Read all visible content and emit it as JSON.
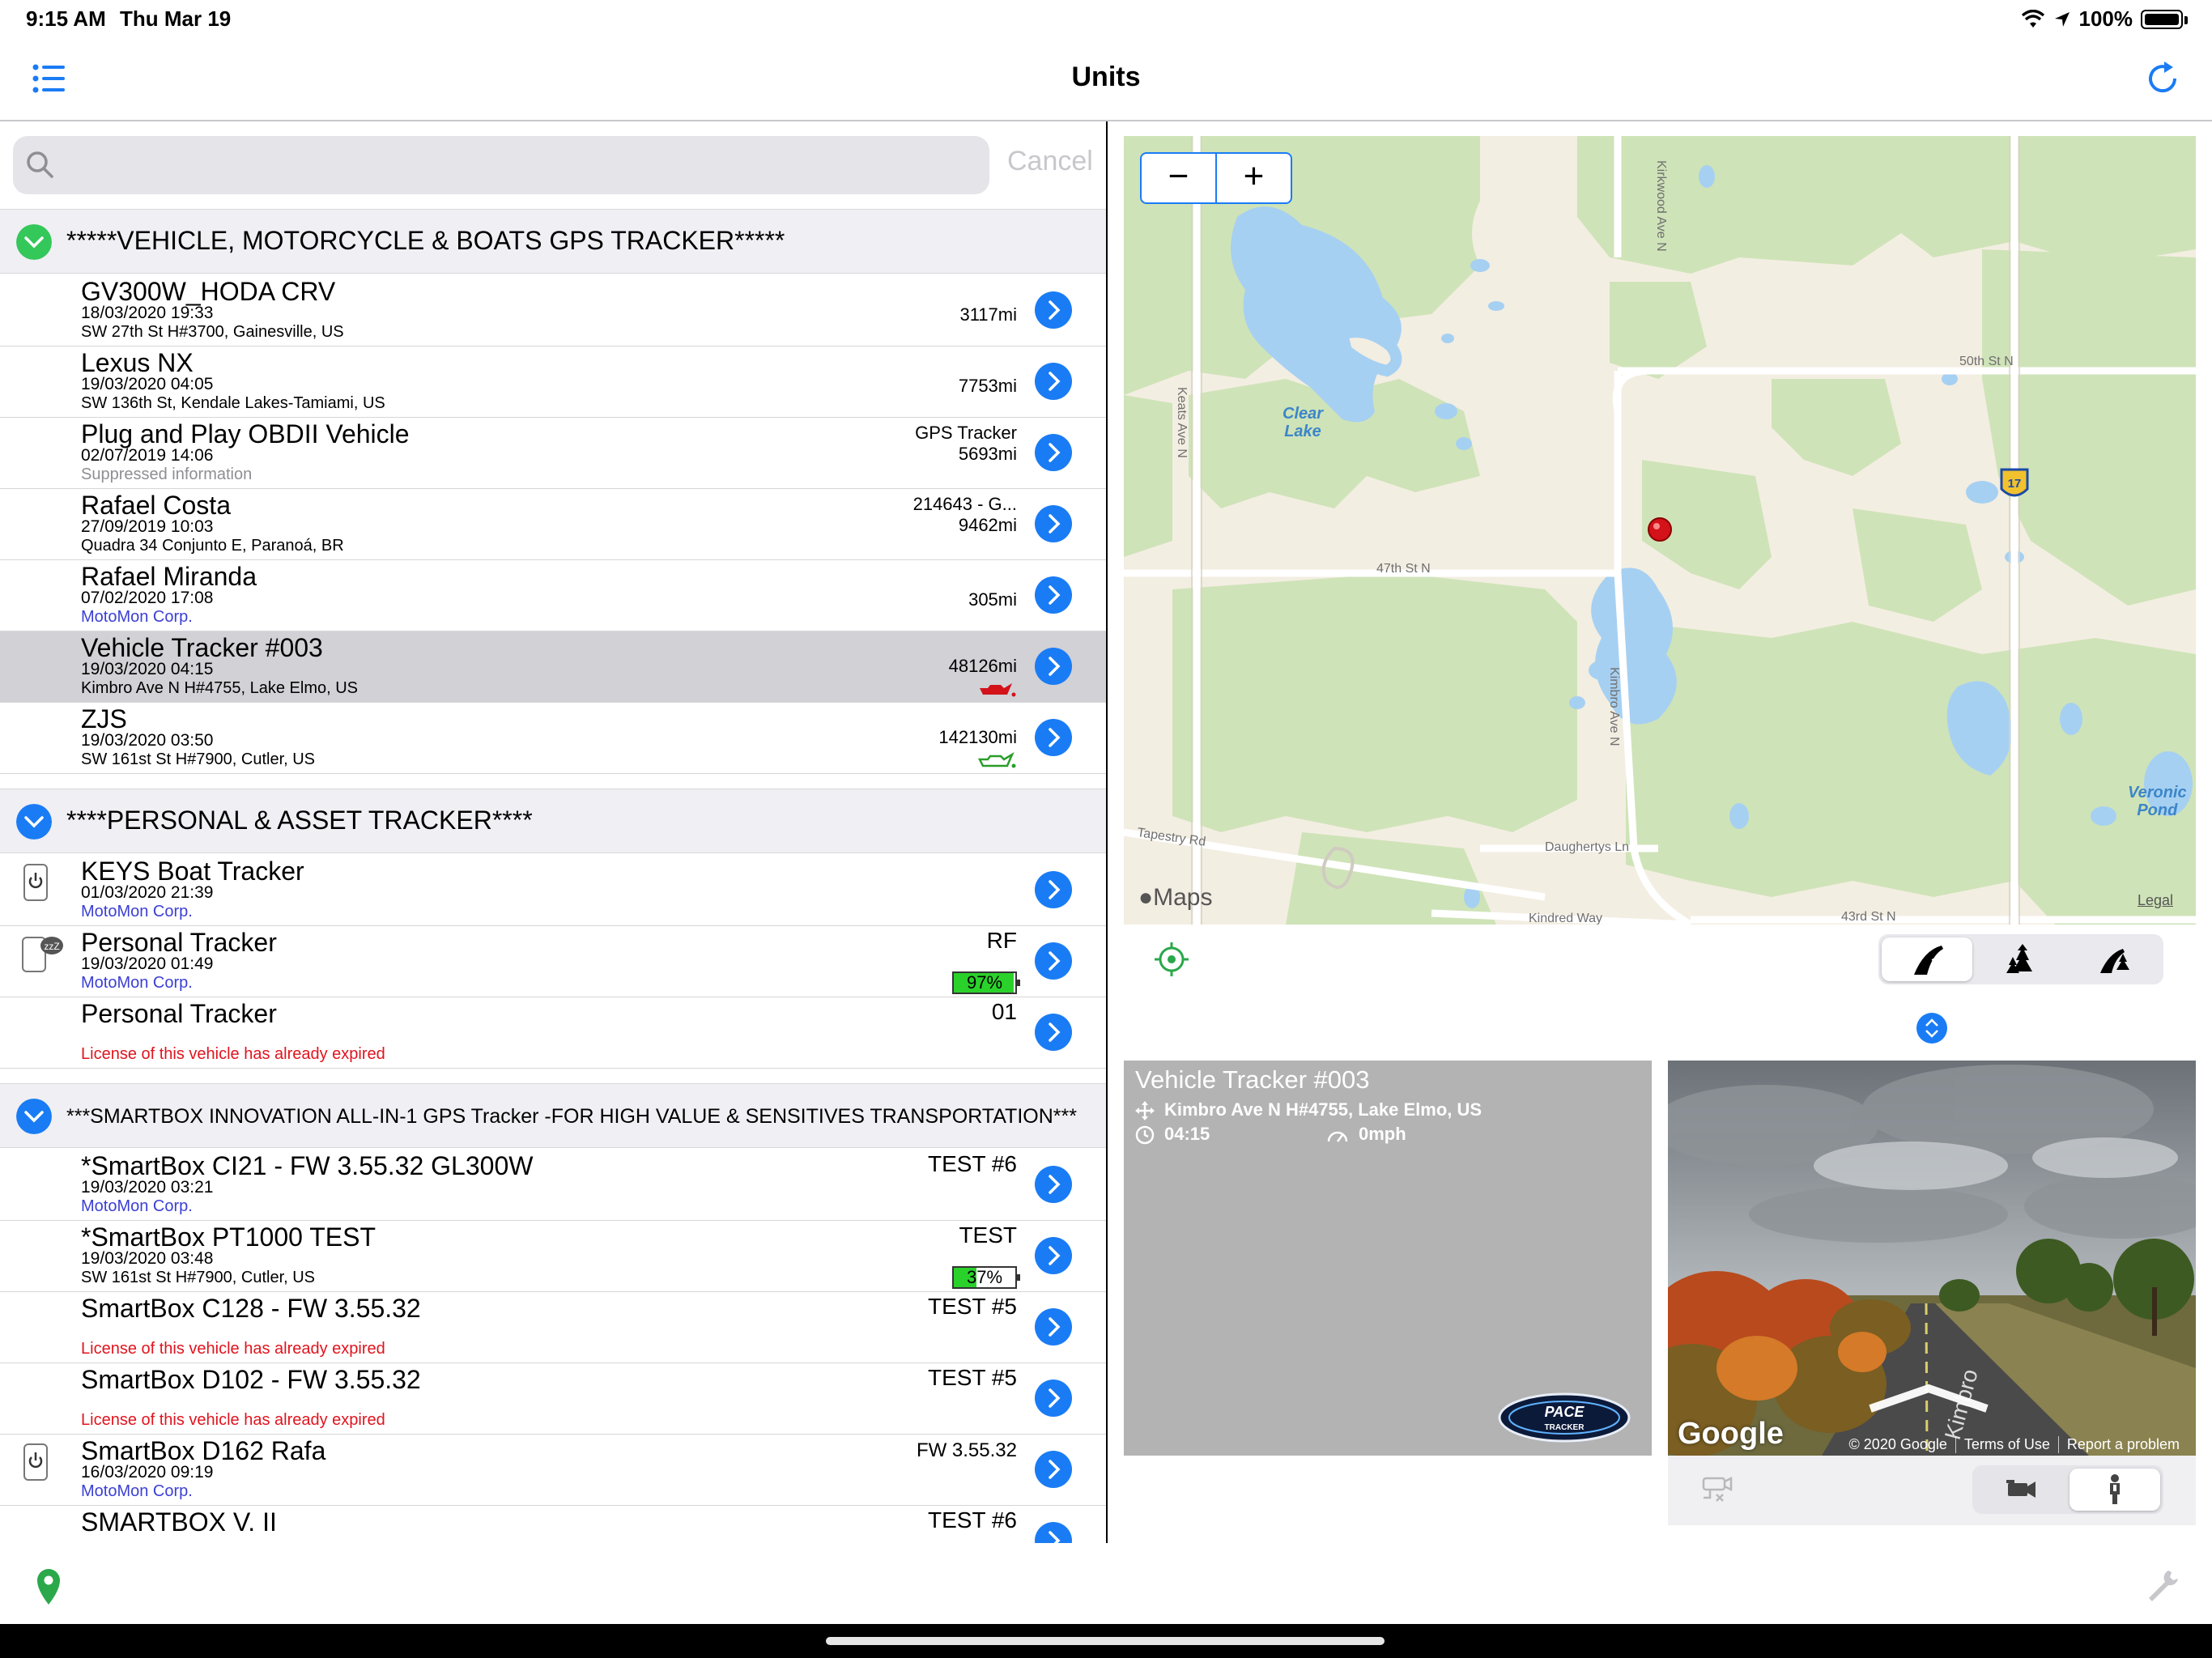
{
  "status": {
    "time": "9:15 AM",
    "date": "Thu Mar 19",
    "battery": "100%"
  },
  "nav": {
    "title": "Units"
  },
  "search": {
    "placeholder": "",
    "cancel": "Cancel"
  },
  "sections": [
    {
      "title": "*****VEHICLE, MOTORCYCLE & BOATS GPS TRACKER*****",
      "color": "#34c759"
    },
    {
      "title": "****PERSONAL & ASSET TRACKER****",
      "color": "#1a7cf5"
    },
    {
      "title": "***SMARTBOX INNOVATION ALL-IN-1 GPS Tracker -FOR HIGH VALUE & SENSITIVES TRANSPORTATION***",
      "color": "#1a7cf5"
    }
  ],
  "units": [
    {
      "name": "GV300W_HODA CRV",
      "time": "18/03/2020 19:33",
      "line3": "SW 27th St H#3700, Gainesville, US",
      "r1": "3117mi"
    },
    {
      "name": "Lexus NX",
      "time": "19/03/2020 04:05",
      "line3": "SW 136th St, Kendale Lakes-Tamiami, US",
      "r1": "7753mi"
    },
    {
      "name": "Plug and Play OBDII Vehicle",
      "time": "02/07/2019 14:06",
      "line3": "Suppressed information",
      "r1": "GPS Tracker",
      "r2": "5693mi"
    },
    {
      "name": "Rafael Costa",
      "time": "27/09/2019 10:03",
      "line3": "Quadra 34 Conjunto E, Paranoá, BR",
      "r1": "214643 - G...",
      "r2": "9462mi"
    },
    {
      "name": "Rafael Miranda",
      "time": "07/02/2020 17:08",
      "line3": "MotoMon Corp.",
      "r1": "305mi"
    },
    {
      "name": "Vehicle Tracker #003",
      "time": "19/03/2020 04:15",
      "line3": "Kimbro Ave N H#4755, Lake Elmo, US",
      "r1": "48126mi"
    },
    {
      "name": "ZJS",
      "time": "19/03/2020 03:50",
      "line3": "SW 161st St H#7900, Cutler, US",
      "r1": "142130mi"
    },
    {
      "name": "KEYS Boat Tracker",
      "time": "01/03/2020 21:39",
      "line3": "MotoMon Corp."
    },
    {
      "name": "Personal Tracker",
      "time": "19/03/2020 01:49",
      "line3": "MotoMon Corp.",
      "rbig": "RF",
      "battery": "97%",
      "battery_level": 0.97
    },
    {
      "name": "Personal Tracker",
      "line3": "License of this vehicle has already expired",
      "rbig": "01"
    },
    {
      "name": "*SmartBox CI21 - FW 3.55.32  GL300W",
      "time": "19/03/2020 03:21",
      "line3": "MotoMon Corp.",
      "rbig": "TEST #6"
    },
    {
      "name": "*SmartBox PT1000 TEST",
      "time": "19/03/2020 03:48",
      "line3": "SW 161st St H#7900, Cutler, US",
      "rbig": "TEST",
      "battery": "37%",
      "battery_level": 0.37
    },
    {
      "name": "SmartBox C128 - FW 3.55.32",
      "line3": "License of this vehicle has already expired",
      "rbig": "TEST #5"
    },
    {
      "name": "SmartBox D102 - FW 3.55.32",
      "line3": "License of this vehicle has already expired",
      "rbig": "TEST #5"
    },
    {
      "name": "SmartBox D162 Rafa",
      "time": "16/03/2020 09:19",
      "line3": "MotoMon Corp.",
      "rbig": "FW 3.55.32"
    },
    {
      "name": "SMARTBOX V. II",
      "rbig": "TEST #6"
    }
  ],
  "map": {
    "zoom_out": "−",
    "zoom_in": "+",
    "labels": {
      "clear_lake": "Clear\nLake",
      "veronica_pond": "Veronic\nPond",
      "kirkwood": "Kirkwood Ave N",
      "keats": "Keats Ave N",
      "fiftieth": "50th St N",
      "fortyseventh": "47th St N",
      "kimbro": "Kimbro Ave N",
      "tapestry": "Tapestry Rd",
      "daughertys": "Daughertys Ln",
      "kindred": "Kindred Way",
      "fortythird": "43rd St N",
      "route": "17"
    },
    "maps_logo": "Maps",
    "legal": "Legal"
  },
  "card": {
    "title": "Vehicle Tracker #003",
    "address": "Kimbro Ave N H#4755, Lake Elmo, US",
    "time": "04:15",
    "speed": "0mph",
    "logo": "PACE TRACKER"
  },
  "streetview": {
    "logo": "Google",
    "copyright": "© 2020 Google",
    "terms": "Terms of Use",
    "report": "Report a problem",
    "road_label": "Kimbro"
  }
}
